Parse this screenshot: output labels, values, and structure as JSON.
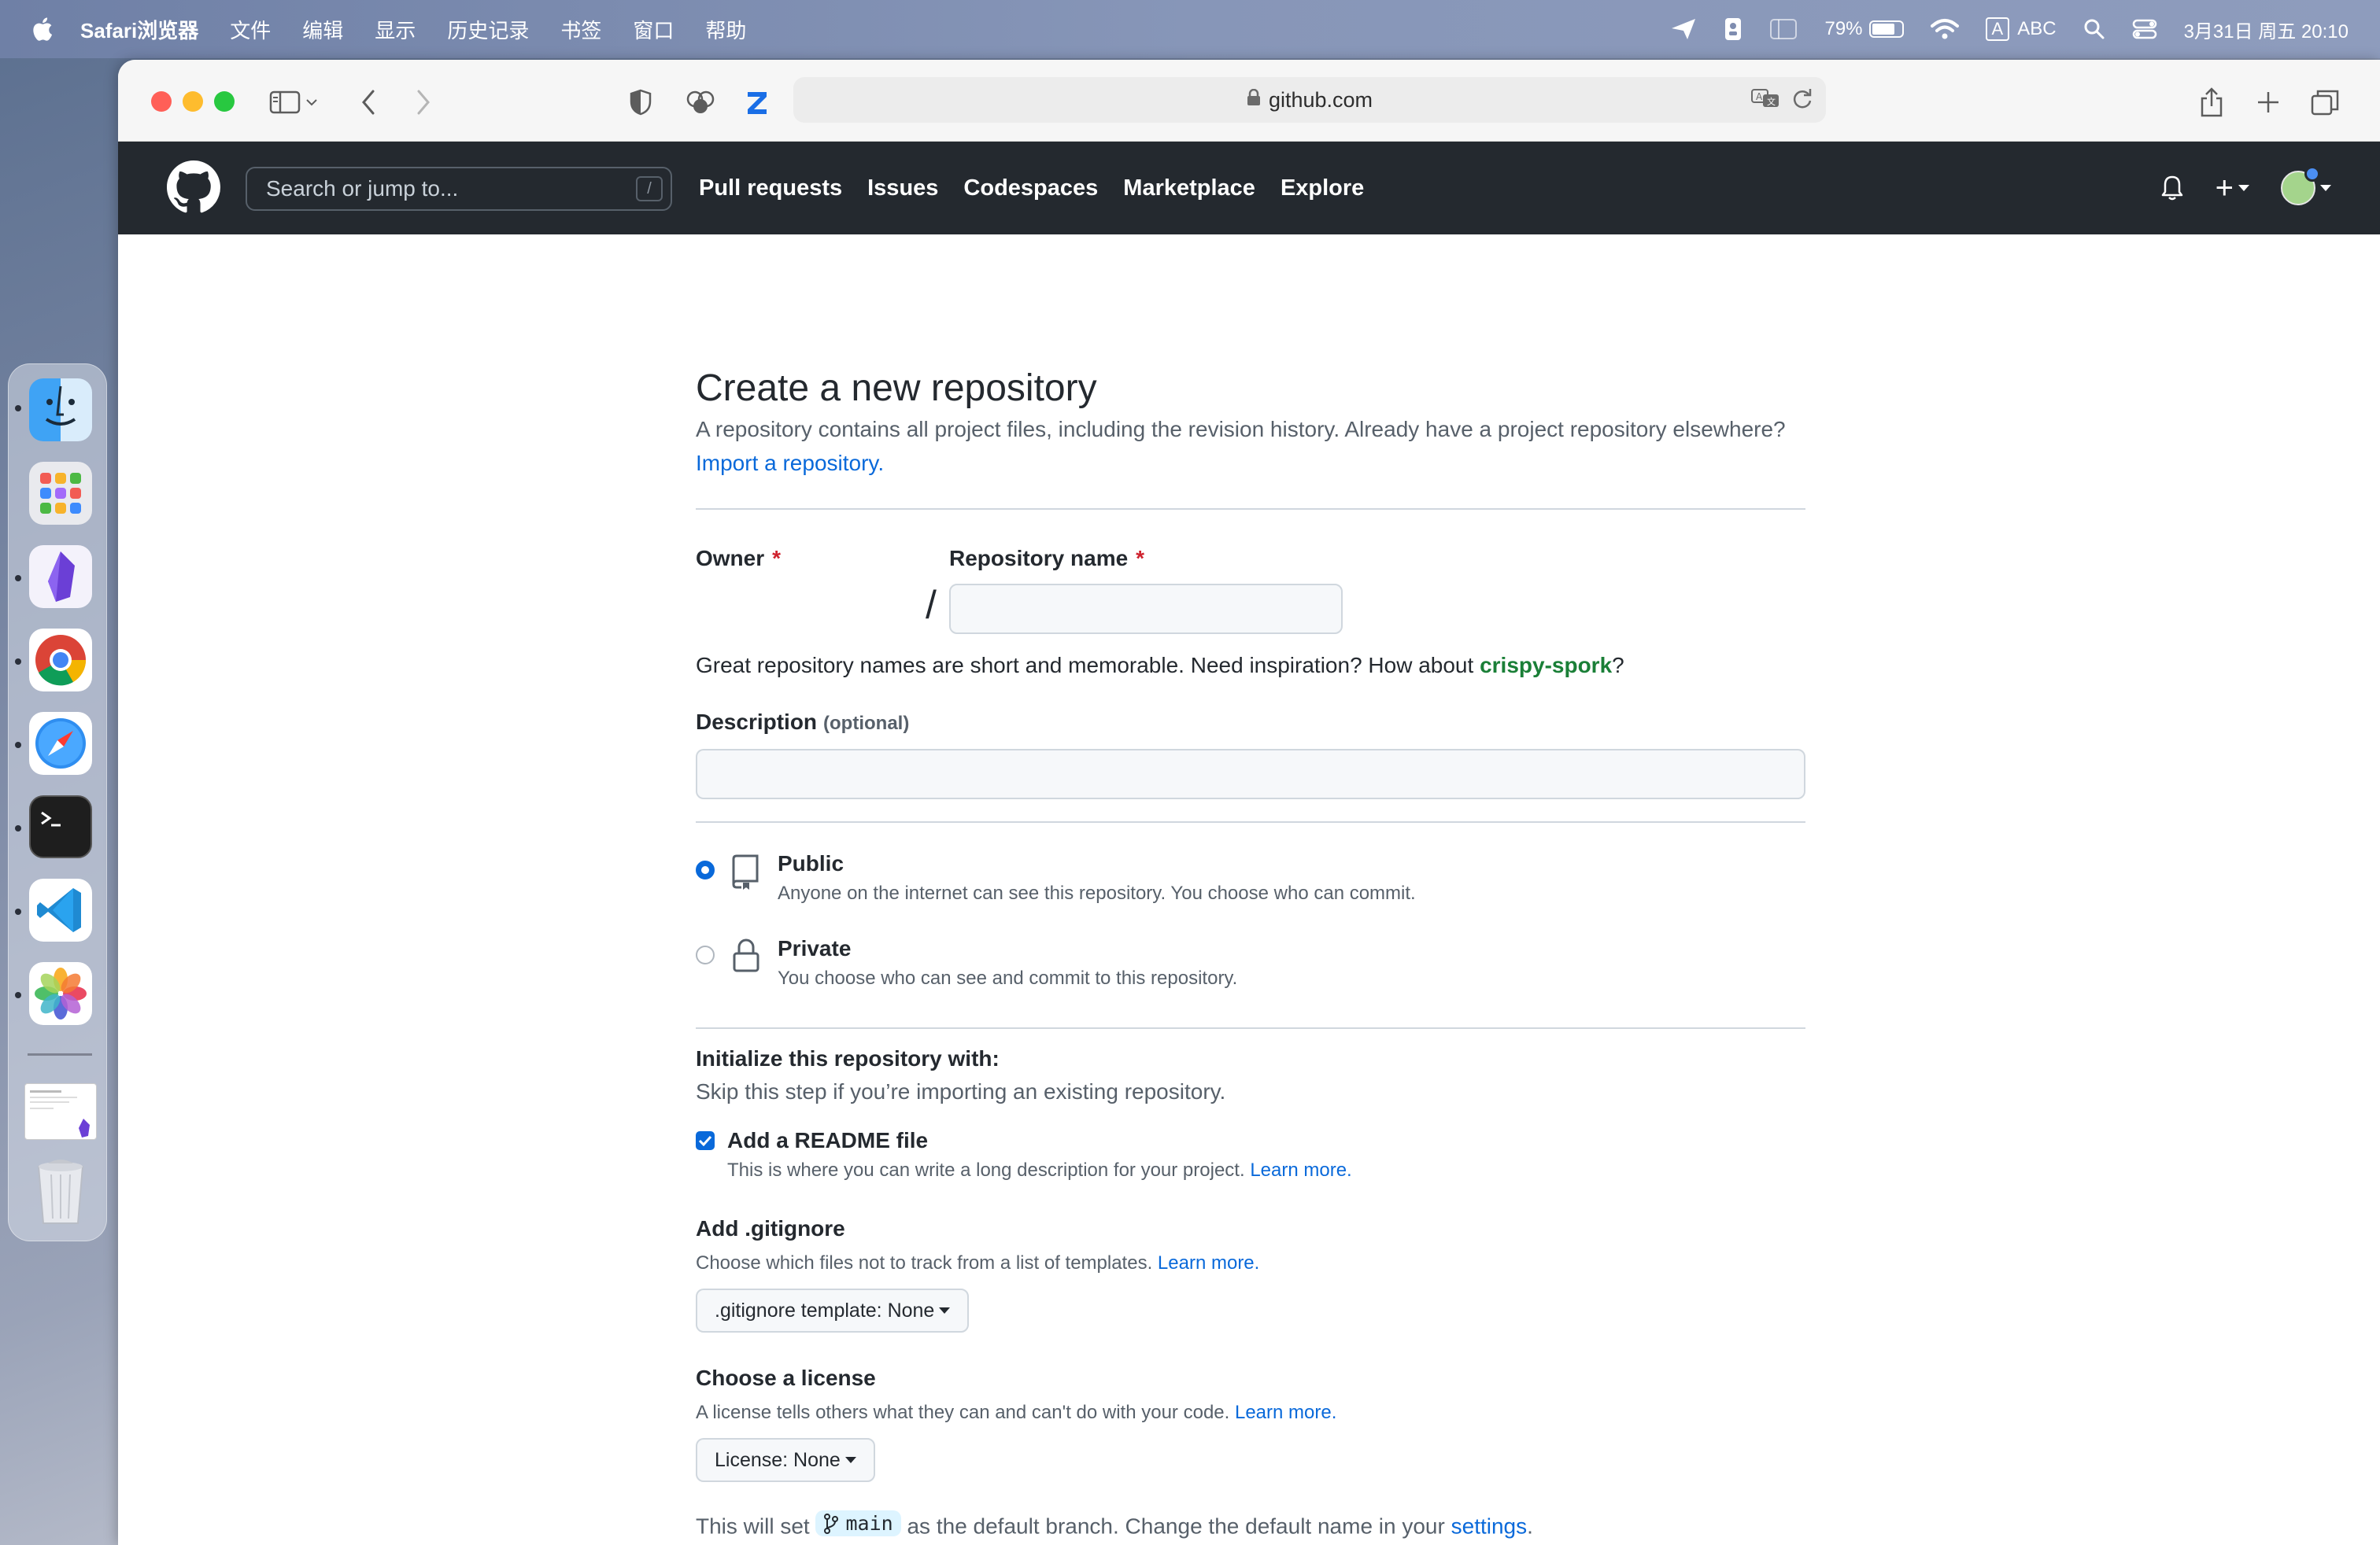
{
  "menubar": {
    "app_name": "Safari浏览器",
    "items": [
      "文件",
      "编辑",
      "显示",
      "历史记录",
      "书签",
      "窗口",
      "帮助"
    ],
    "battery_percent": "79%",
    "battery_level": 0.79,
    "input_method": "ABC",
    "input_badge": "A",
    "datetime": "3月31日 周五 20:10"
  },
  "dock": {
    "apps": [
      "Finder",
      "Launchpad",
      "Obsidian",
      "Chrome",
      "Safari",
      "Terminal",
      "VS Code",
      "Photos"
    ]
  },
  "browser": {
    "url": "github.com"
  },
  "github_header": {
    "search_placeholder": "Search or jump to...",
    "search_shortcut": "/",
    "nav": {
      "pull_requests": "Pull requests",
      "issues": "Issues",
      "codespaces": "Codespaces",
      "marketplace": "Marketplace",
      "explore": "Explore"
    },
    "new_label": "+"
  },
  "form": {
    "title": "Create a new repository",
    "description_text": "A repository contains all project files, including the revision history. Already have a project repository elsewhere?",
    "import_link": "Import a repository.",
    "owner_label": "Owner",
    "repo_name_label": "Repository name",
    "required_mark": "*",
    "slash": "/",
    "repo_name_value": "",
    "inspiration_prefix": "Great repository names are short and memorable. Need inspiration? How about",
    "inspiration_suggestion": "crispy-spork",
    "inspiration_suffix": "?",
    "description_label": "Description",
    "description_optional": "(optional)",
    "description_value": "",
    "visibility": {
      "selected": "Public",
      "public_title": "Public",
      "public_desc": "Anyone on the internet can see this repository. You choose who can commit.",
      "private_title": "Private",
      "private_desc": "You choose who can see and commit to this repository."
    },
    "init": {
      "title": "Initialize this repository with:",
      "subtitle": "Skip this step if you’re importing an existing repository.",
      "readme_label": "Add a README file",
      "readme_checked": true,
      "readme_desc": "This is where you can write a long description for your project.",
      "learn_more": "Learn more."
    },
    "gitignore": {
      "title": "Add .gitignore",
      "desc": "Choose which files not to track from a list of templates.",
      "learn_more": "Learn more.",
      "button": ".gitignore template: None"
    },
    "license": {
      "title": "Choose a license",
      "desc": "A license tells others what they can and can't do with your code.",
      "learn_more": "Learn more.",
      "button": "License: None"
    },
    "branch": {
      "prefix": "This will set",
      "name": "main",
      "middle": "as the default branch. Change the default name in your",
      "settings_link": "settings",
      "suffix": "."
    }
  },
  "colors": {
    "accent": "#0969da",
    "header_bg": "#24292f",
    "required": "#cf222e",
    "suggestion": "#1a7f37"
  }
}
